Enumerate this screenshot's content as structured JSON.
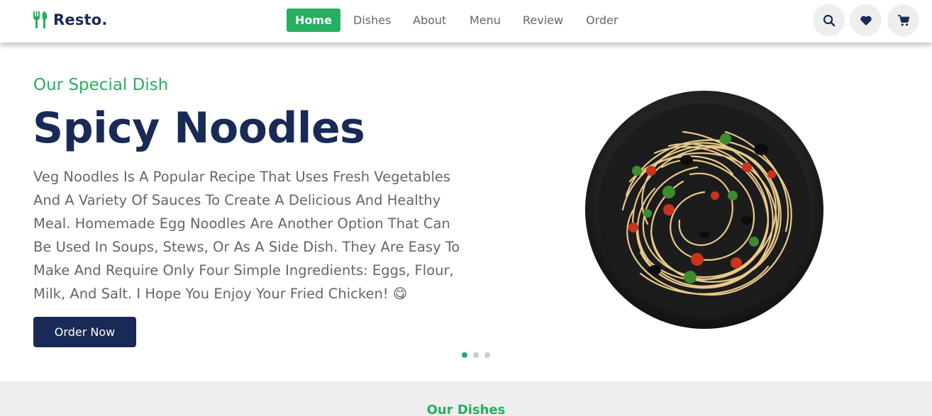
{
  "header": {
    "logo_text": "Resto.",
    "nav": [
      {
        "label": "Home",
        "active": true
      },
      {
        "label": "Dishes",
        "active": false
      },
      {
        "label": "About",
        "active": false
      },
      {
        "label": "Menu",
        "active": false
      },
      {
        "label": "Review",
        "active": false
      },
      {
        "label": "Order",
        "active": false
      }
    ],
    "icons": [
      "search-icon",
      "heart-icon",
      "cart-icon"
    ]
  },
  "hero": {
    "subtitle": "Our Special Dish",
    "title": "Spicy Noodles",
    "description": "Veg Noodles Is A Popular Recipe That Uses Fresh Vegetables And A Variety Of Sauces To Create A Delicious And Healthy Meal. Homemade Egg Noodles Are Another Option That Can Be Used In Soups, Stews, Or As A Side Dish. They Are Easy To Make And Require Only Four Simple Ingredients: Eggs, Flour, Milk, And Salt. I Hope You Enjoy Your Fried Chicken! 😋",
    "order_button": "Order Now",
    "slides": 3,
    "active_slide": 1
  },
  "section2": {
    "heading": "Our Dishes"
  },
  "colors": {
    "accent": "#27ae60",
    "primary": "#192a56",
    "text_muted": "#666666",
    "icon_bg": "#eeeeee"
  }
}
